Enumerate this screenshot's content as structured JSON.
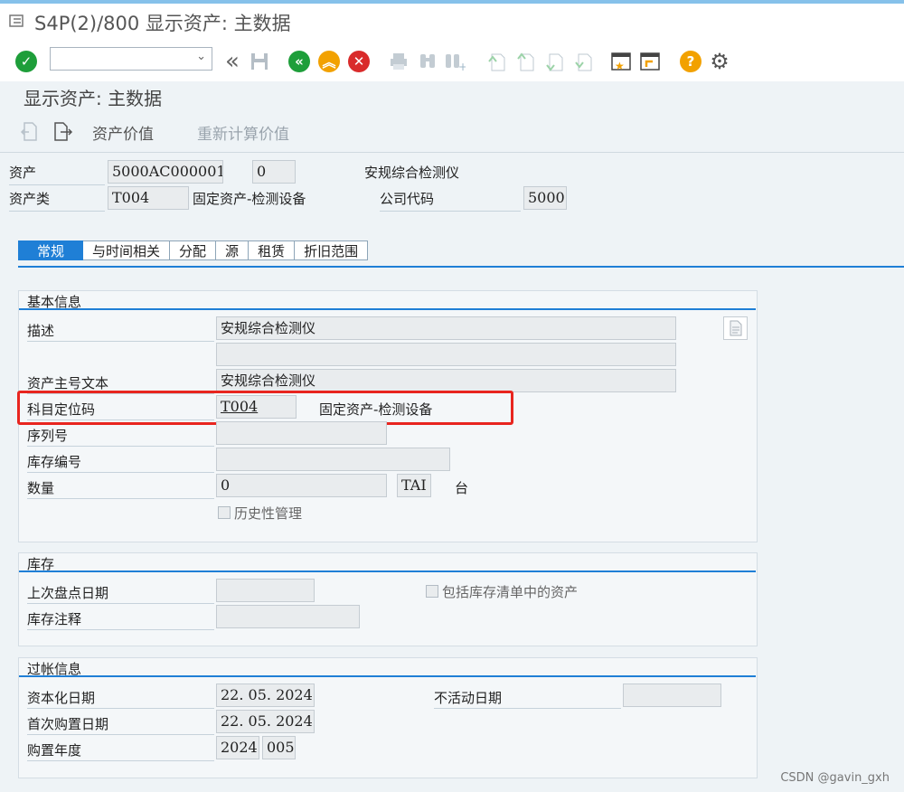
{
  "window": {
    "title": "S4P(2)/800 显示资产: 主数据"
  },
  "toolbar": {
    "command_value": ""
  },
  "page": {
    "title": "显示资产: 主数据"
  },
  "appbar": {
    "asset_value": "资产价值",
    "recalc_value": "重新计算价值"
  },
  "header": {
    "asset_label": "资产",
    "asset_no": "5000AC000001",
    "sub_no": "0",
    "asset_desc": "安规综合检测仪",
    "class_label": "资产类",
    "class_code": "T004",
    "class_desc": "固定资产-检测设备",
    "company_label": "公司代码",
    "company_code": "5000"
  },
  "tabs": [
    {
      "label": "常规",
      "active": true
    },
    {
      "label": "与时间相关"
    },
    {
      "label": "分配"
    },
    {
      "label": "源"
    },
    {
      "label": "租赁"
    },
    {
      "label": "折旧范围"
    }
  ],
  "basic": {
    "title": "基本信息",
    "desc_label": "描述",
    "desc_value": "安规综合检测仪",
    "desc_value2": "",
    "main_text_label": "资产主号文本",
    "main_text_value": "安规综合检测仪",
    "acct_label": "科目定位码",
    "acct_value": "T004",
    "acct_desc": "固定资产-检测设备",
    "serial_label": "序列号",
    "serial_value": "",
    "inv_label": "库存编号",
    "inv_value": "",
    "qty_label": "数量",
    "qty_value": "0",
    "unit_value": "TAI",
    "unit_text": "台",
    "history_label": "历史性管理"
  },
  "inventory": {
    "title": "库存",
    "last_date_label": "上次盘点日期",
    "last_date_value": "",
    "note_label": "库存注释",
    "note_value": "",
    "include_label": "包括库存清单中的资产"
  },
  "posting": {
    "title": "过帐信息",
    "cap_date_label": "资本化日期",
    "cap_date_value": "22. 05. 2024",
    "first_acq_label": "首次购置日期",
    "first_acq_value": "22. 05. 2024",
    "acq_year_label": "购置年度",
    "acq_year_value": "2024",
    "acq_period_value": "005",
    "deact_label": "不活动日期",
    "deact_value": ""
  },
  "watermark": "CSDN @gavin_gxh",
  "colors": {
    "accent": "#1f7fd6",
    "highlight": "#e8251f",
    "ok": "#1e9e3a",
    "exit": "#f2a100",
    "cancel": "#d92b2b"
  }
}
